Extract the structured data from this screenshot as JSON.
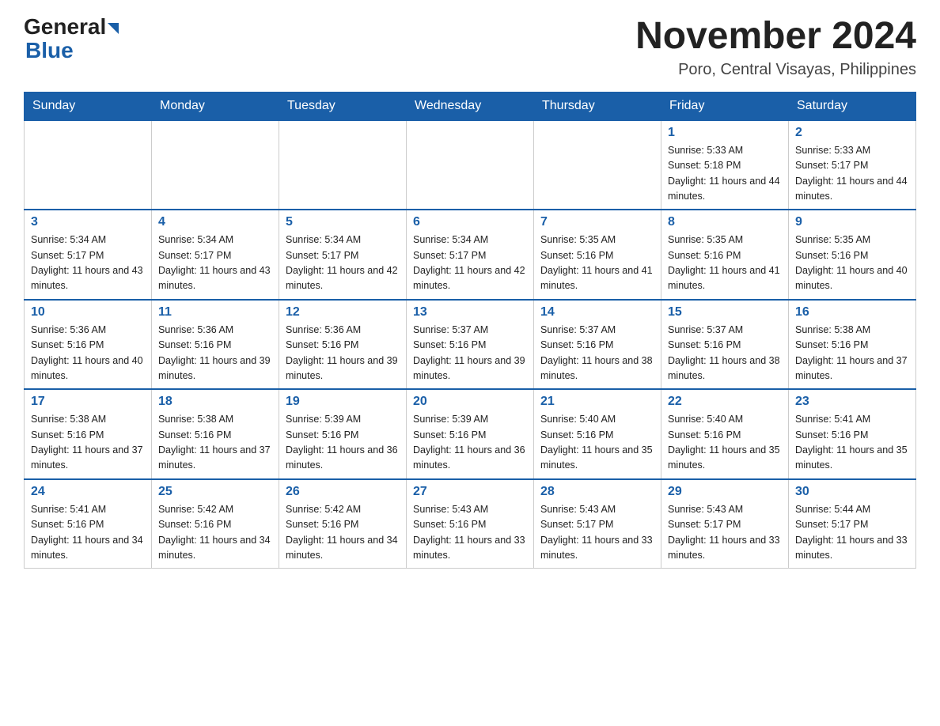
{
  "logo": {
    "general": "General",
    "blue": "Blue"
  },
  "title": "November 2024",
  "subtitle": "Poro, Central Visayas, Philippines",
  "headers": [
    "Sunday",
    "Monday",
    "Tuesday",
    "Wednesday",
    "Thursday",
    "Friday",
    "Saturday"
  ],
  "weeks": [
    [
      {
        "day": "",
        "sunrise": "",
        "sunset": "",
        "daylight": ""
      },
      {
        "day": "",
        "sunrise": "",
        "sunset": "",
        "daylight": ""
      },
      {
        "day": "",
        "sunrise": "",
        "sunset": "",
        "daylight": ""
      },
      {
        "day": "",
        "sunrise": "",
        "sunset": "",
        "daylight": ""
      },
      {
        "day": "",
        "sunrise": "",
        "sunset": "",
        "daylight": ""
      },
      {
        "day": "1",
        "sunrise": "Sunrise: 5:33 AM",
        "sunset": "Sunset: 5:18 PM",
        "daylight": "Daylight: 11 hours and 44 minutes."
      },
      {
        "day": "2",
        "sunrise": "Sunrise: 5:33 AM",
        "sunset": "Sunset: 5:17 PM",
        "daylight": "Daylight: 11 hours and 44 minutes."
      }
    ],
    [
      {
        "day": "3",
        "sunrise": "Sunrise: 5:34 AM",
        "sunset": "Sunset: 5:17 PM",
        "daylight": "Daylight: 11 hours and 43 minutes."
      },
      {
        "day": "4",
        "sunrise": "Sunrise: 5:34 AM",
        "sunset": "Sunset: 5:17 PM",
        "daylight": "Daylight: 11 hours and 43 minutes."
      },
      {
        "day": "5",
        "sunrise": "Sunrise: 5:34 AM",
        "sunset": "Sunset: 5:17 PM",
        "daylight": "Daylight: 11 hours and 42 minutes."
      },
      {
        "day": "6",
        "sunrise": "Sunrise: 5:34 AM",
        "sunset": "Sunset: 5:17 PM",
        "daylight": "Daylight: 11 hours and 42 minutes."
      },
      {
        "day": "7",
        "sunrise": "Sunrise: 5:35 AM",
        "sunset": "Sunset: 5:16 PM",
        "daylight": "Daylight: 11 hours and 41 minutes."
      },
      {
        "day": "8",
        "sunrise": "Sunrise: 5:35 AM",
        "sunset": "Sunset: 5:16 PM",
        "daylight": "Daylight: 11 hours and 41 minutes."
      },
      {
        "day": "9",
        "sunrise": "Sunrise: 5:35 AM",
        "sunset": "Sunset: 5:16 PM",
        "daylight": "Daylight: 11 hours and 40 minutes."
      }
    ],
    [
      {
        "day": "10",
        "sunrise": "Sunrise: 5:36 AM",
        "sunset": "Sunset: 5:16 PM",
        "daylight": "Daylight: 11 hours and 40 minutes."
      },
      {
        "day": "11",
        "sunrise": "Sunrise: 5:36 AM",
        "sunset": "Sunset: 5:16 PM",
        "daylight": "Daylight: 11 hours and 39 minutes."
      },
      {
        "day": "12",
        "sunrise": "Sunrise: 5:36 AM",
        "sunset": "Sunset: 5:16 PM",
        "daylight": "Daylight: 11 hours and 39 minutes."
      },
      {
        "day": "13",
        "sunrise": "Sunrise: 5:37 AM",
        "sunset": "Sunset: 5:16 PM",
        "daylight": "Daylight: 11 hours and 39 minutes."
      },
      {
        "day": "14",
        "sunrise": "Sunrise: 5:37 AM",
        "sunset": "Sunset: 5:16 PM",
        "daylight": "Daylight: 11 hours and 38 minutes."
      },
      {
        "day": "15",
        "sunrise": "Sunrise: 5:37 AM",
        "sunset": "Sunset: 5:16 PM",
        "daylight": "Daylight: 11 hours and 38 minutes."
      },
      {
        "day": "16",
        "sunrise": "Sunrise: 5:38 AM",
        "sunset": "Sunset: 5:16 PM",
        "daylight": "Daylight: 11 hours and 37 minutes."
      }
    ],
    [
      {
        "day": "17",
        "sunrise": "Sunrise: 5:38 AM",
        "sunset": "Sunset: 5:16 PM",
        "daylight": "Daylight: 11 hours and 37 minutes."
      },
      {
        "day": "18",
        "sunrise": "Sunrise: 5:38 AM",
        "sunset": "Sunset: 5:16 PM",
        "daylight": "Daylight: 11 hours and 37 minutes."
      },
      {
        "day": "19",
        "sunrise": "Sunrise: 5:39 AM",
        "sunset": "Sunset: 5:16 PM",
        "daylight": "Daylight: 11 hours and 36 minutes."
      },
      {
        "day": "20",
        "sunrise": "Sunrise: 5:39 AM",
        "sunset": "Sunset: 5:16 PM",
        "daylight": "Daylight: 11 hours and 36 minutes."
      },
      {
        "day": "21",
        "sunrise": "Sunrise: 5:40 AM",
        "sunset": "Sunset: 5:16 PM",
        "daylight": "Daylight: 11 hours and 35 minutes."
      },
      {
        "day": "22",
        "sunrise": "Sunrise: 5:40 AM",
        "sunset": "Sunset: 5:16 PM",
        "daylight": "Daylight: 11 hours and 35 minutes."
      },
      {
        "day": "23",
        "sunrise": "Sunrise: 5:41 AM",
        "sunset": "Sunset: 5:16 PM",
        "daylight": "Daylight: 11 hours and 35 minutes."
      }
    ],
    [
      {
        "day": "24",
        "sunrise": "Sunrise: 5:41 AM",
        "sunset": "Sunset: 5:16 PM",
        "daylight": "Daylight: 11 hours and 34 minutes."
      },
      {
        "day": "25",
        "sunrise": "Sunrise: 5:42 AM",
        "sunset": "Sunset: 5:16 PM",
        "daylight": "Daylight: 11 hours and 34 minutes."
      },
      {
        "day": "26",
        "sunrise": "Sunrise: 5:42 AM",
        "sunset": "Sunset: 5:16 PM",
        "daylight": "Daylight: 11 hours and 34 minutes."
      },
      {
        "day": "27",
        "sunrise": "Sunrise: 5:43 AM",
        "sunset": "Sunset: 5:16 PM",
        "daylight": "Daylight: 11 hours and 33 minutes."
      },
      {
        "day": "28",
        "sunrise": "Sunrise: 5:43 AM",
        "sunset": "Sunset: 5:17 PM",
        "daylight": "Daylight: 11 hours and 33 minutes."
      },
      {
        "day": "29",
        "sunrise": "Sunrise: 5:43 AM",
        "sunset": "Sunset: 5:17 PM",
        "daylight": "Daylight: 11 hours and 33 minutes."
      },
      {
        "day": "30",
        "sunrise": "Sunrise: 5:44 AM",
        "sunset": "Sunset: 5:17 PM",
        "daylight": "Daylight: 11 hours and 33 minutes."
      }
    ]
  ]
}
